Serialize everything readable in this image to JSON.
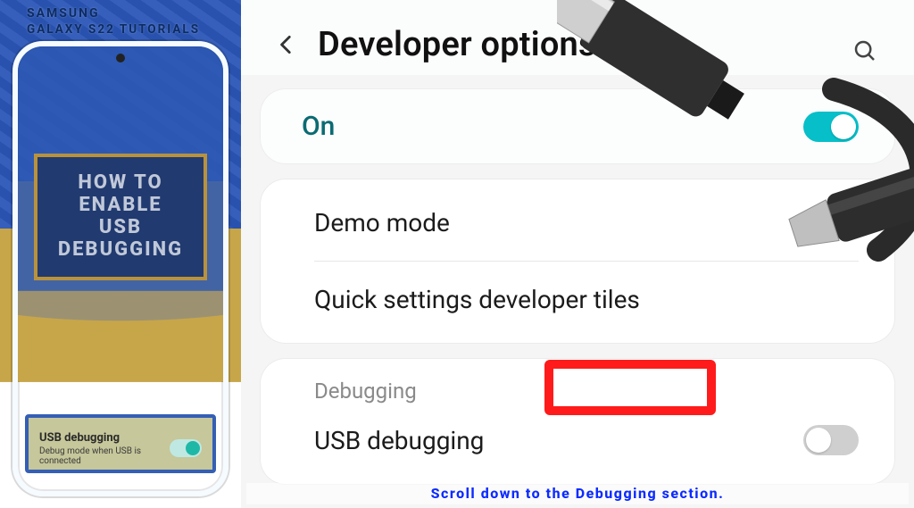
{
  "brand": {
    "line1": "SAMSUNG",
    "line2": "GALAXY S22 TUTORIALS"
  },
  "title_card": {
    "l1": "HOW TO",
    "l2": "ENABLE",
    "l3": "USB",
    "l4": "DEBUGGING"
  },
  "mini": {
    "title": "USB debugging",
    "sub": "Debug mode when USB is connected"
  },
  "header": {
    "title": "Developer options"
  },
  "master": {
    "label": "On"
  },
  "rows": {
    "demo": "Demo mode",
    "quick": "Quick settings developer tiles",
    "section": "Debugging",
    "usb": "USB debugging"
  },
  "caption": "Scroll down to the Debugging section."
}
